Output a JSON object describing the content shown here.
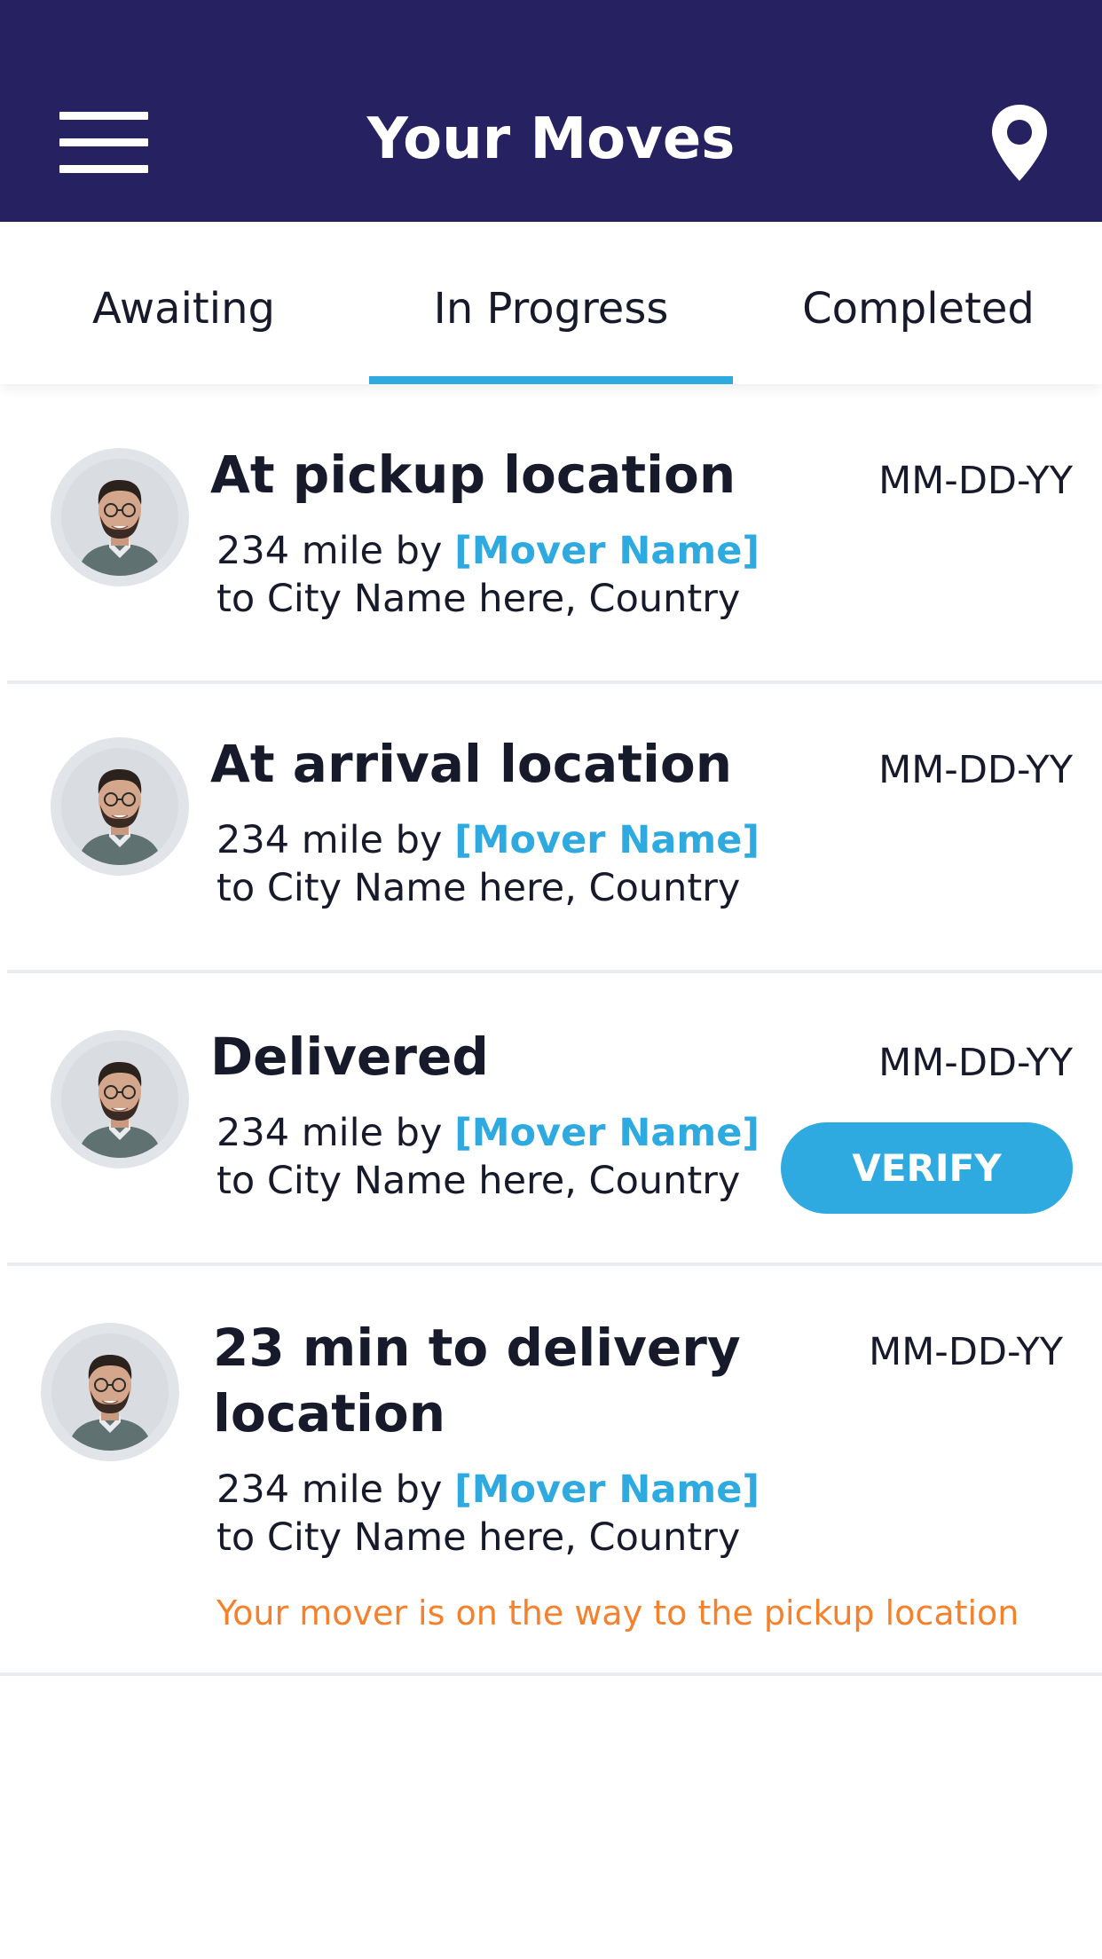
{
  "header": {
    "title": "Your Moves",
    "background_color": "#262262",
    "menu_icon": "hamburger-menu-icon",
    "location_icon": "map-pin-icon"
  },
  "tabs": [
    {
      "label": "Awaiting",
      "active": false
    },
    {
      "label": "In Progress",
      "active": true
    },
    {
      "label": "Completed",
      "active": false
    }
  ],
  "accent_color": "#2eaae1",
  "moves": [
    {
      "status": "At pickup location",
      "date": "MM-DD-YY",
      "distance": "234 mile by",
      "mover_name": "[Mover Name]",
      "destination": "to City Name here, Country"
    },
    {
      "status": "At arrival location",
      "date": "MM-DD-YY",
      "distance": "234 mile by",
      "mover_name": "[Mover Name]",
      "destination": "to City Name here, Country"
    },
    {
      "status": "Delivered",
      "date": "MM-DD-YY",
      "distance": "234 mile by",
      "mover_name": "[Mover Name]",
      "destination": "to City Name here, Country",
      "action_label": "VERIFY"
    },
    {
      "status_line1": "23 min to delivery",
      "status_line2": "location",
      "date": "MM-DD-YY",
      "distance": "234 mile by",
      "mover_name": "[Mover Name]",
      "destination": "to City Name here, Country",
      "note": "Your mover is on the way to the pickup location",
      "note_color": "#f5812c"
    }
  ]
}
